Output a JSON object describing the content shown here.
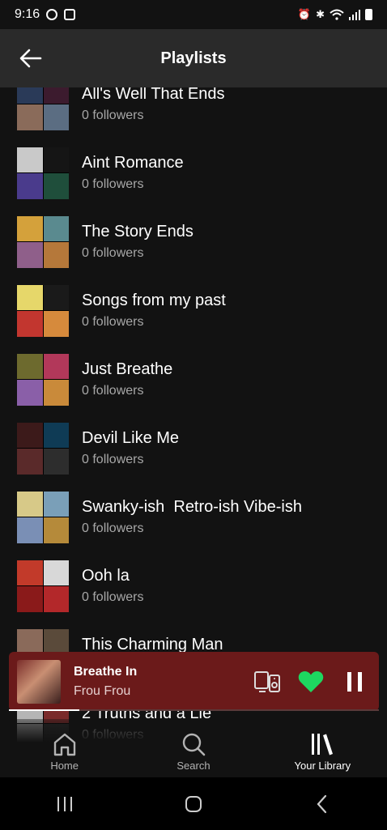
{
  "status_bar": {
    "time": "9:16"
  },
  "header": {
    "title": "Playlists"
  },
  "playlists": [
    {
      "title": "All's Well That Ends",
      "subtitle": "0 followers",
      "colors": [
        "#2a3a58",
        "#3c1b2e",
        "#8a6b5a",
        "#5b6d82"
      ]
    },
    {
      "title": "Aint Romance",
      "subtitle": "0 followers",
      "colors": [
        "#c9c9c9",
        "#151515",
        "#4a3b8c",
        "#1f4e3b"
      ]
    },
    {
      "title": "The Story Ends",
      "subtitle": "0 followers",
      "colors": [
        "#d4a13b",
        "#5a8a8f",
        "#8f5f8a",
        "#b5783a"
      ]
    },
    {
      "title": "Songs from my past",
      "subtitle": "0 followers",
      "colors": [
        "#e6d76a",
        "#1a1a1a",
        "#c2362f",
        "#d68a3c"
      ]
    },
    {
      "title": "Just Breathe",
      "subtitle": "0 followers",
      "colors": [
        "#6d6a2e",
        "#b2385a",
        "#8a5fa8",
        "#c98a3a"
      ]
    },
    {
      "title": "Devil Like Me",
      "subtitle": "0 followers",
      "colors": [
        "#3c1a1a",
        "#0f3b55",
        "#5a2a2a",
        "#2d2d2d"
      ]
    },
    {
      "title": "Swanky-ish  Retro-ish Vibe-ish",
      "subtitle": "0 followers",
      "colors": [
        "#d7c988",
        "#7a9fb8",
        "#7a8fb5",
        "#b58a3a"
      ]
    },
    {
      "title": "Ooh la",
      "subtitle": "0 followers",
      "colors": [
        "#c23a2a",
        "#d8d8d8",
        "#8a1a1a",
        "#b3282a"
      ]
    },
    {
      "title": "This Charming Man",
      "subtitle": "0 followers",
      "colors": [
        "#8a6a5a",
        "#5a4a3a",
        "#a38a7a",
        "#6a5a4a"
      ]
    },
    {
      "title": "2 Truths and a Lie",
      "subtitle": "0 followers",
      "colors": [
        "#b5b5b5",
        "#7a2a2a",
        "#8f8f8f",
        "#2a2a2a"
      ]
    }
  ],
  "now_playing": {
    "title": "Breathe In",
    "artist": "Frou Frou",
    "progress": 0.19,
    "accent": "#6b1a1a",
    "heart_color": "#1ed760"
  },
  "tabs": [
    {
      "label": "Home",
      "icon": "home-icon"
    },
    {
      "label": "Search",
      "icon": "search-icon"
    },
    {
      "label": "Your Library",
      "icon": "library-icon"
    }
  ]
}
